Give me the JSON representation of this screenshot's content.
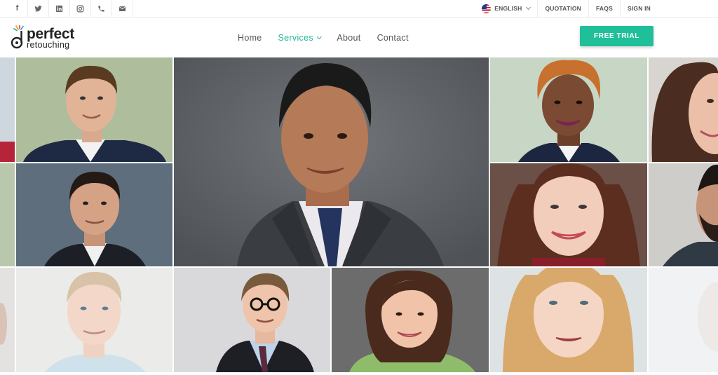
{
  "topbar": {
    "social": [
      {
        "icon": "facebook-icon"
      },
      {
        "icon": "twitter-icon"
      },
      {
        "icon": "linkedin-icon"
      },
      {
        "icon": "instagram-icon"
      },
      {
        "icon": "phone-icon"
      },
      {
        "icon": "mail-icon"
      }
    ],
    "language": "ENGLISH",
    "quotation": "QUOTATION",
    "faqs": "FAQS",
    "signin": "SIGN IN"
  },
  "header": {
    "logo_main": "perfect",
    "logo_sub": "retouching",
    "nav": {
      "home": "Home",
      "services": "Services",
      "about": "About",
      "contact": "Contact"
    },
    "cta": "FREE TRIAL"
  },
  "colors": {
    "accent": "#1fbf99",
    "nav_active": "#22b99a",
    "text": "#555555"
  }
}
